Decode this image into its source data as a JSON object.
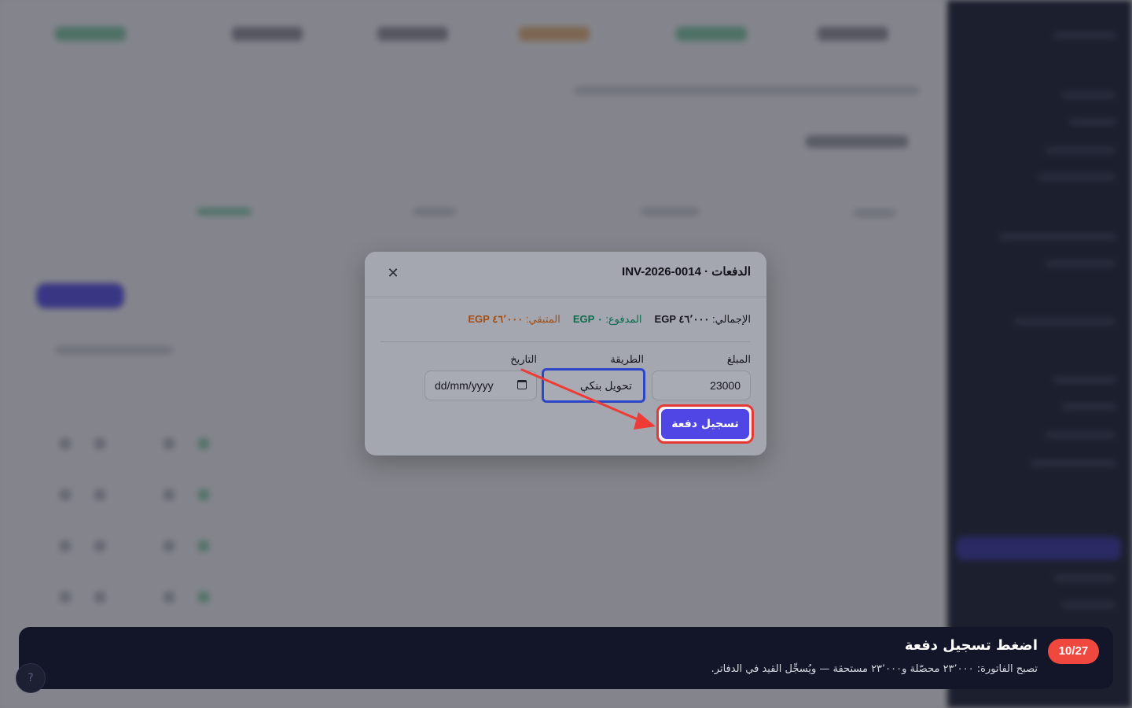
{
  "modal": {
    "title": "الدفعات · INV-2026-0014",
    "close_icon": "✕",
    "totals": {
      "total_label": "الإجمالي:",
      "total_value": "EGP ٤٦٬٠٠٠",
      "paid_label": "المدفوع:",
      "paid_value": "EGP ٠",
      "remaining_label": "المتبقي:",
      "remaining_value": "EGP ٤٦٬٠٠٠"
    },
    "fields": {
      "amount_label": "المبلغ",
      "amount_value": "23000",
      "method_label": "الطريقة",
      "method_value": "تحويل بنكي",
      "date_label": "التاريخ",
      "date_placeholder": "dd/mm/yyyy"
    },
    "submit_label": "تسجيل دفعة"
  },
  "tour": {
    "step": "10/27",
    "title": "اضغط تسجيل دفعة",
    "description": "تصبح الفاتورة: ٢٣٬٠٠٠ محصّلة و٢٣٬٠٠٠ مستحقة — ويُسجِّل القيد في الدفاتر."
  },
  "colors": {
    "accent": "#4f46e5",
    "highlight": "#e53935",
    "paid": "#0b6b4b",
    "remaining": "#a44d10",
    "tour_bg": "#121628",
    "sidebar_bg": "#0f1326"
  }
}
